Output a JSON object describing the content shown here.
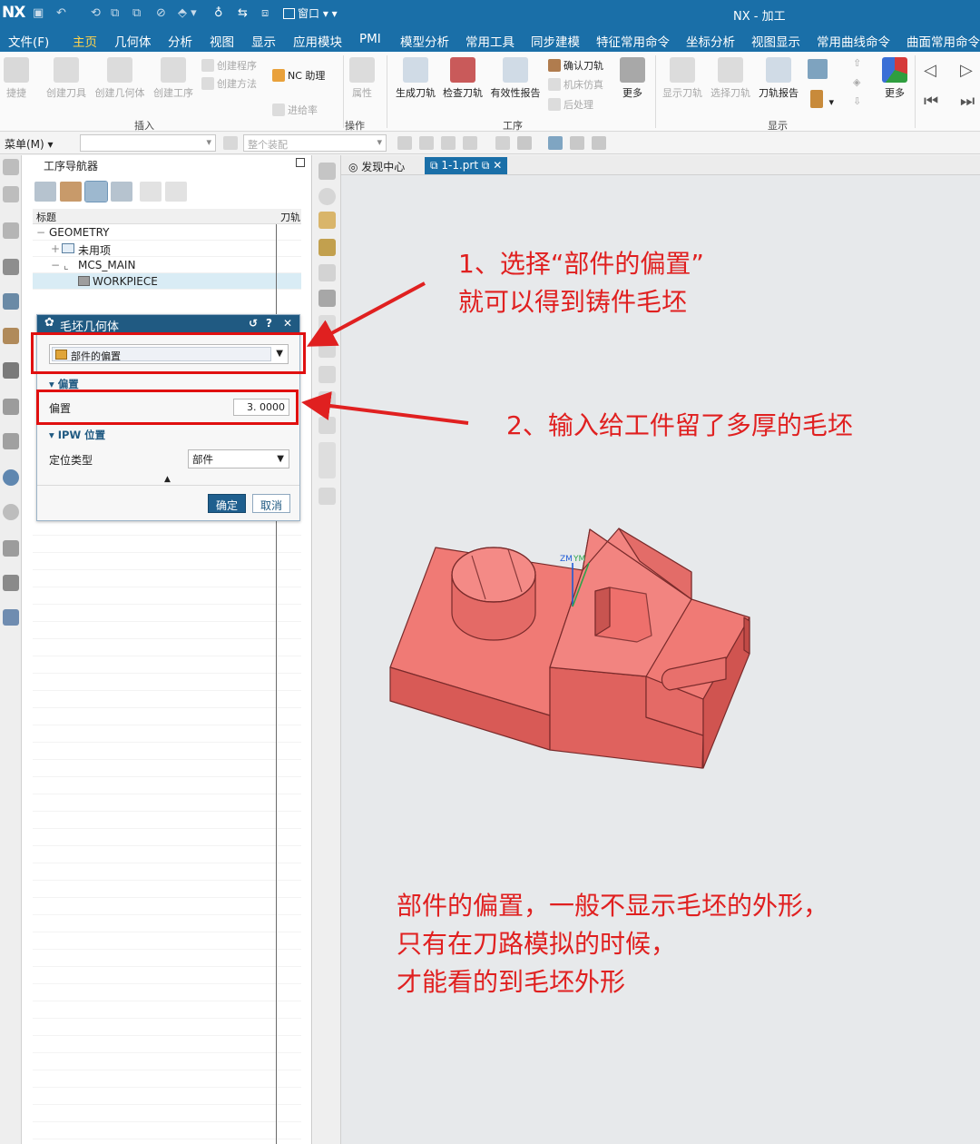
{
  "titlebar": {
    "logo": "NX",
    "window_menu": "窗口",
    "title": "NX - 加工"
  },
  "menu_tabs": [
    {
      "label": "文件(F)"
    },
    {
      "label": "主页",
      "active": true
    },
    {
      "label": "几何体"
    },
    {
      "label": "分析"
    },
    {
      "label": "视图"
    },
    {
      "label": "显示"
    },
    {
      "label": "应用模块"
    },
    {
      "label": "PMI"
    },
    {
      "label": "模型分析"
    },
    {
      "label": "常用工具"
    },
    {
      "label": "同步建模"
    },
    {
      "label": "特征常用命令"
    },
    {
      "label": "坐标分析"
    },
    {
      "label": "视图显示"
    },
    {
      "label": "常用曲线命令"
    },
    {
      "label": "曲面常用命令"
    }
  ],
  "ribbon": {
    "quick_build": "捷捷",
    "create_tool": "创建刀具",
    "create_geometry": "创建几何体",
    "create_operation": "创建工序",
    "create_program": "创建程序",
    "create_method": "创建方法",
    "nc_assistant": "NC 助理",
    "feed_rate": "进给率",
    "properties": "属性",
    "generate_toolpath": "生成刀轨",
    "verify_toolpath": "检查刀轨",
    "validity_report": "有效性报告",
    "confirm_toolpath": "确认刀轨",
    "machine_simulation": "机床仿真",
    "postprocess": "后处理",
    "more": "更多",
    "show_toolpath": "显示刀轨",
    "select_toolpath": "选择刀轨",
    "toolpath_report": "刀轨报告",
    "more2": "更多",
    "group_insert": "插入",
    "group_operation": "操作",
    "group_process": "工序",
    "group_display": "显示"
  },
  "cmdbar": {
    "menu": "菜单(M) ▾",
    "filter_placeholder": "整个装配"
  },
  "navigator": {
    "title": "工序导航器",
    "col_name": "标题",
    "col_toolpath": "刀轨",
    "rows": [
      {
        "label": "GEOMETRY",
        "prefix": "−"
      },
      {
        "label": "未用项",
        "prefix": "+"
      },
      {
        "label": "MCS_MAIN",
        "prefix": "−"
      },
      {
        "label": "WORKPIECE",
        "prefix": ""
      }
    ]
  },
  "dialog": {
    "title": "毛坯几何体",
    "type_value": "部件的偏置",
    "section_offset": "偏置",
    "offset_label": "偏置",
    "offset_value": "3. 0000",
    "section_ipw": "IPW 位置",
    "position_label": "定位类型",
    "position_value": "部件",
    "ok": "确定",
    "cancel": "取消"
  },
  "doc_tabs": {
    "discover": "发现中心",
    "part": "1-1.prt"
  },
  "axis_labels": {
    "zm": "ZM",
    "ym": "YM"
  },
  "annotations": {
    "a1_line1": "1、选择“部件的偏置”",
    "a1_line2": "就可以得到铸件毛坯",
    "a2": "2、输入给工件留了多厚的毛坯",
    "a3_line1": "部件的偏置，一般不显示毛坯的外形，",
    "a3_line2": "只有在刀路模拟的时候，",
    "a3_line3": "才能看的到毛坯外形"
  },
  "colors": {
    "title_bar": "#1a6fa8",
    "dialog_header": "#205a82",
    "part_red": "#f26e6b",
    "annotation_red": "#e02020"
  }
}
